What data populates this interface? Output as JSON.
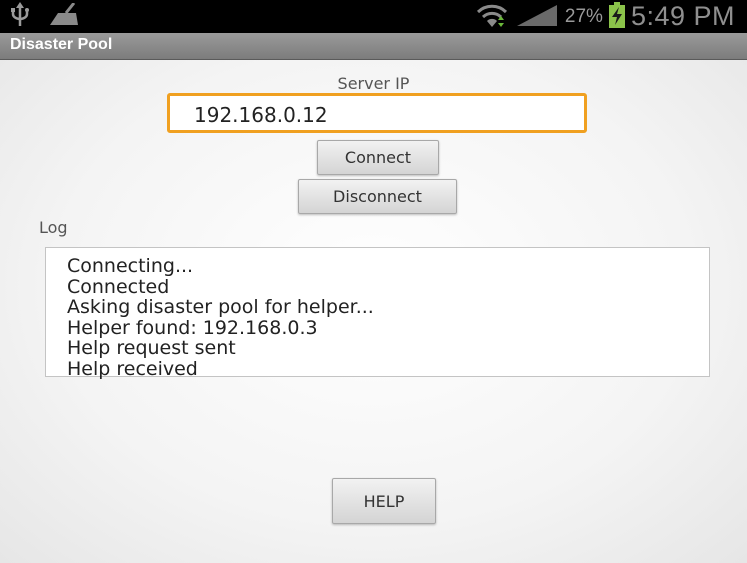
{
  "status_bar": {
    "battery_percent": "27%",
    "time": "5:49 PM",
    "icons": [
      "usb-icon",
      "cleaner-icon",
      "wifi-icon",
      "signal-icon",
      "battery-charging-icon"
    ]
  },
  "app": {
    "title": "Disaster Pool"
  },
  "form": {
    "server_ip_label": "Server IP",
    "server_ip_value": "192.168.0.12",
    "connect_label": "Connect",
    "disconnect_label": "Disconnect"
  },
  "log": {
    "label": "Log",
    "lines": [
      "Connecting...",
      "Connected",
      "Asking disaster pool for helper...",
      "Helper found: 192.168.0.3",
      "Help request sent",
      "Help received"
    ]
  },
  "help_button": {
    "label": "HELP"
  },
  "colors": {
    "input_focus_border": "#f0a020",
    "battery_charging": "#8bc34a"
  }
}
